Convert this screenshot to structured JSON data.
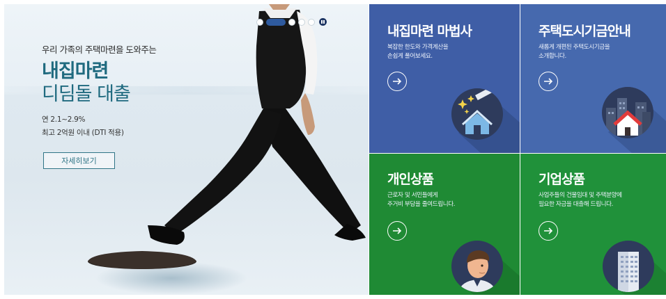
{
  "hero": {
    "subtitle": "우리 가족의 주택마련을 도와주는",
    "title_strong": "내집마련",
    "title_light": "디딤돌 대출",
    "rate": "연 2.1~2.9%",
    "limit": "최고 2억원 이내 (DTI 적용)",
    "detail_button": "자세히보기",
    "pager": {
      "total_slides": 5,
      "active_slide": 2,
      "pause_icon": "pause-icon"
    }
  },
  "tiles": [
    {
      "title": "내집마련 마법사",
      "desc": "복잡한 한도와 가격계산을\n손쉽게 풀어보세요.",
      "icon": "house-magic-wand-icon",
      "color": "#3f5ea6"
    },
    {
      "title": "주택도시기금안내",
      "desc": "새롭게 개편된 주택도시기금을\n소개합니다.",
      "icon": "city-house-icon",
      "color": "#4669ae"
    },
    {
      "title": "개인상품",
      "desc": "근로자 및 서민들에게\n주거비 부담을 줄여드립니다.",
      "icon": "person-avatar-icon",
      "color": "#1f8a34"
    },
    {
      "title": "기업상품",
      "desc": "사업주들의 건물임대 및 주택분양에\n필요한 자금을 대출해 드립니다.",
      "icon": "office-building-icon",
      "color": "#20913a"
    }
  ],
  "arrow_icon": "arrow-right-icon"
}
